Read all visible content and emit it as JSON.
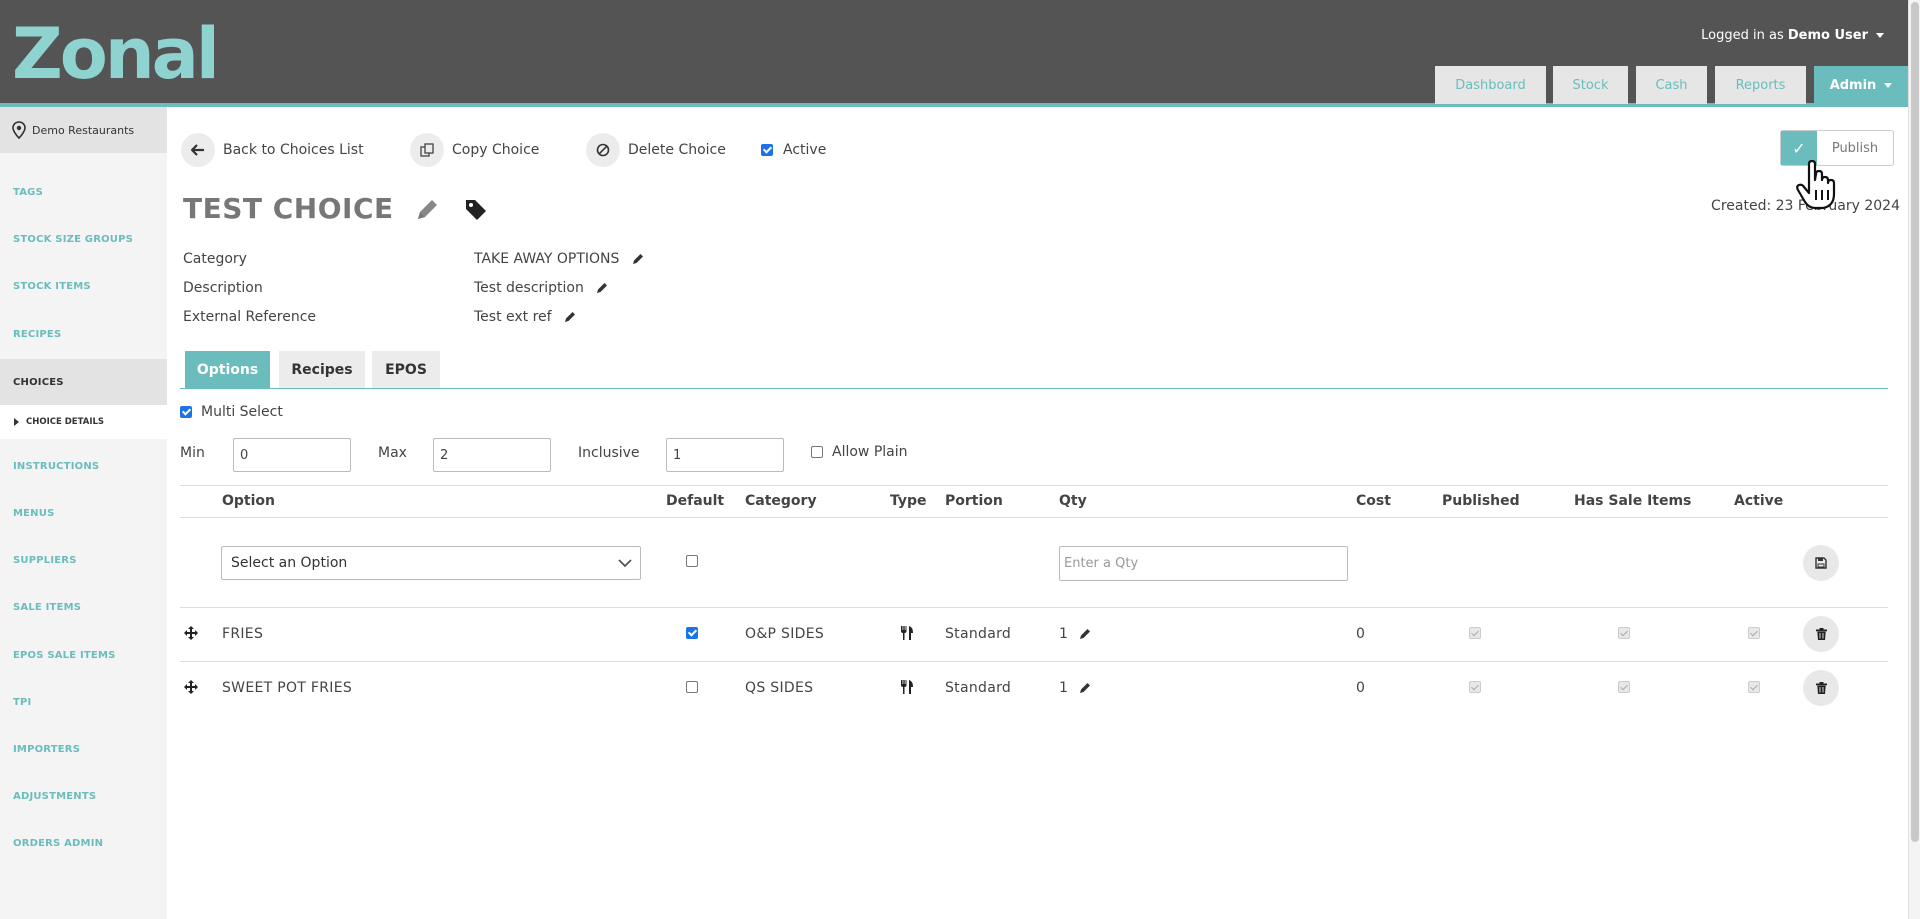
{
  "brand": {
    "logo_text": "Zonal",
    "accent": "#6bbcbc",
    "header_bg": "#545454"
  },
  "header": {
    "logged_prefix": "Logged in as",
    "user": "Demo User",
    "nav": [
      "Dashboard",
      "Stock",
      "Cash",
      "Reports",
      "Admin"
    ]
  },
  "sidebar": {
    "site": "Demo Restaurants",
    "items": [
      "TAGS",
      "STOCK SIZE GROUPS",
      "STOCK ITEMS",
      "RECIPES",
      "CHOICES",
      "CHOICE DETAILS",
      "INSTRUCTIONS",
      "MENUS",
      "SUPPLIERS",
      "SALE ITEMS",
      "EPOS SALE ITEMS",
      "TPI",
      "IMPORTERS",
      "ADJUSTMENTS",
      "ORDERS ADMIN"
    ],
    "active": "CHOICES",
    "sub_active": "CHOICE DETAILS"
  },
  "toolbar": {
    "back": "Back to Choices List",
    "copy": "Copy Choice",
    "delete": "Delete Choice",
    "active_label": "Active",
    "active_checked": true,
    "publish": "Publish",
    "publish_icon": "check-icon"
  },
  "choice": {
    "title": "TEST CHOICE",
    "created": "Created: 23 February 2024",
    "fields": [
      {
        "label": "Category",
        "value": "TAKE AWAY OPTIONS"
      },
      {
        "label": "Description",
        "value": "Test description"
      },
      {
        "label": "External Reference",
        "value": "Test ext ref"
      }
    ]
  },
  "tabs": [
    "Options",
    "Recipes",
    "EPOS"
  ],
  "active_tab": "Options",
  "settings": {
    "multi_select_label": "Multi Select",
    "multi_select": true,
    "min_label": "Min",
    "min": "0",
    "max_label": "Max",
    "max": "2",
    "inclusive_label": "Inclusive",
    "inclusive": "1",
    "allow_plain_label": "Allow Plain",
    "allow_plain": false
  },
  "table": {
    "headers": [
      "Option",
      "Default",
      "Category",
      "Type",
      "Portion",
      "Qty",
      "Cost",
      "Published",
      "Has Sale Items",
      "Active"
    ],
    "new_row": {
      "select_placeholder": "Select an Option",
      "qty_placeholder": "Enter a Qty"
    },
    "rows": [
      {
        "option": "FRIES",
        "default": true,
        "category": "O&P SIDES",
        "type_icon": "food-icon",
        "portion": "Standard",
        "qty": "1",
        "cost": "0"
      },
      {
        "option": "SWEET POT FRIES",
        "default": false,
        "category": "QS SIDES",
        "type_icon": "food-icon",
        "portion": "Standard",
        "qty": "1",
        "cost": "0"
      }
    ]
  }
}
